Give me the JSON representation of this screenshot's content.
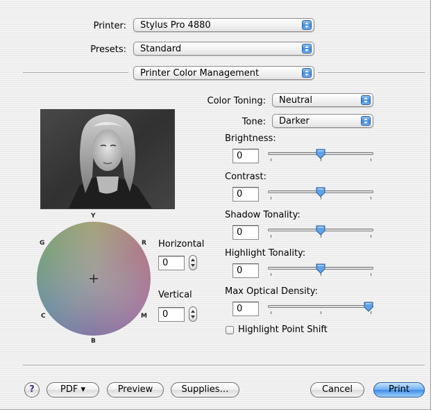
{
  "printer": {
    "label": "Printer:",
    "value": "Stylus Pro 4880"
  },
  "presets": {
    "label": "Presets:",
    "value": "Standard"
  },
  "section": {
    "value": "Printer Color Management"
  },
  "color_toning": {
    "label": "Color Toning:",
    "value": "Neutral"
  },
  "tone": {
    "label": "Tone:",
    "value": "Darker"
  },
  "sliders": [
    {
      "label": "Brightness:",
      "value": "0",
      "position": 0.5
    },
    {
      "label": "Contrast:",
      "value": "0",
      "position": 0.5
    },
    {
      "label": "Shadow Tonality:",
      "value": "0",
      "position": 0.5
    },
    {
      "label": "Highlight Tonality:",
      "value": "0",
      "position": 0.5
    },
    {
      "label": "Max Optical Density:",
      "value": "0",
      "position": 1.0
    }
  ],
  "wheel": {
    "Y": "Y",
    "R": "R",
    "M": "M",
    "B": "B",
    "C": "C",
    "G": "G"
  },
  "horizontal": {
    "label": "Horizontal",
    "value": "0"
  },
  "vertical": {
    "label": "Vertical",
    "value": "0"
  },
  "highlight_point_shift": {
    "label": "Highlight Point Shift",
    "checked": false
  },
  "buttons": {
    "help": "?",
    "pdf": "PDF ▾",
    "preview": "Preview",
    "supplies": "Supplies…",
    "cancel": "Cancel",
    "print": "Print"
  },
  "colors": {
    "accent": "#3c8ce6",
    "thumb": "#5ea3ea"
  }
}
